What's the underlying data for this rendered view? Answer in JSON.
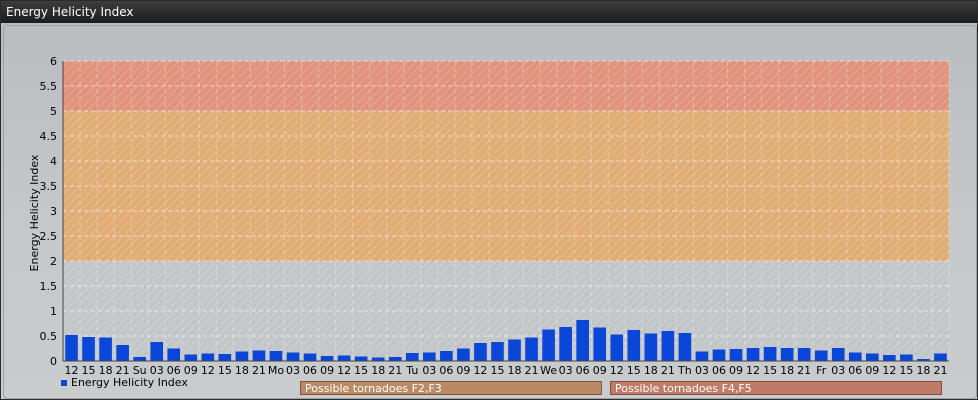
{
  "window": {
    "title": "Energy Helicity Index"
  },
  "chart_data": {
    "type": "bar",
    "ylabel": "Energy Helicity Index",
    "ylim": [
      0,
      6
    ],
    "ytick_labels": [
      "0",
      "0.5",
      "1",
      "1.5",
      "2",
      "2.5",
      "3",
      "3.5",
      "4",
      "4.5",
      "5",
      "5.5",
      "6"
    ],
    "yticks": [
      0,
      0.5,
      1,
      1.5,
      2,
      2.5,
      3,
      3.5,
      4,
      4.5,
      5,
      5.5,
      6
    ],
    "grid": true,
    "legend_placement": "bottom-left",
    "categories": [
      "12",
      "15",
      "18",
      "21",
      "Su",
      "03",
      "06",
      "09",
      "12",
      "15",
      "18",
      "21",
      "Mo",
      "03",
      "06",
      "09",
      "12",
      "15",
      "18",
      "21",
      "Tu",
      "03",
      "06",
      "09",
      "12",
      "15",
      "18",
      "21",
      "We",
      "03",
      "06",
      "09",
      "12",
      "15",
      "18",
      "21",
      "Th",
      "03",
      "06",
      "09",
      "12",
      "15",
      "18",
      "21",
      "Fr",
      "03",
      "06",
      "09",
      "12",
      "15",
      "18",
      "21"
    ],
    "series": [
      {
        "name": "Energy Helicity Index",
        "color": "#0a47d9",
        "values": [
          0.52,
          0.48,
          0.47,
          0.32,
          0.08,
          0.38,
          0.25,
          0.13,
          0.15,
          0.14,
          0.19,
          0.21,
          0.2,
          0.17,
          0.15,
          0.1,
          0.11,
          0.09,
          0.07,
          0.08,
          0.16,
          0.17,
          0.2,
          0.25,
          0.36,
          0.38,
          0.43,
          0.47,
          0.63,
          0.68,
          0.82,
          0.67,
          0.53,
          0.62,
          0.55,
          0.6,
          0.56,
          0.19,
          0.23,
          0.24,
          0.26,
          0.28,
          0.26,
          0.26,
          0.21,
          0.26,
          0.17,
          0.15,
          0.12,
          0.13,
          0.04,
          0.15
        ]
      }
    ],
    "bands": [
      {
        "from": 2,
        "to": 5,
        "label": "Possible tornadoes F2,F3",
        "color": "#e6a868"
      },
      {
        "from": 5,
        "to": 6,
        "label": "Possible tornadoes F4,F5",
        "color": "#e68a70"
      }
    ],
    "legend_band_colors": [
      "#b98a63",
      "#bf7a68"
    ]
  }
}
